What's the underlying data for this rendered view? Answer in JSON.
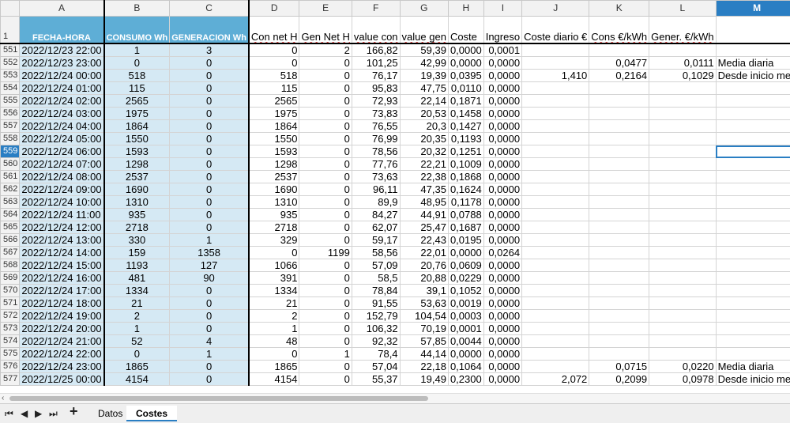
{
  "columns": [
    "",
    "A",
    "B",
    "C",
    "D",
    "E",
    "F",
    "G",
    "H",
    "I",
    "J",
    "K",
    "L",
    "M"
  ],
  "selected_column": "M",
  "selected_row": "559",
  "header_row": {
    "row_number": "1",
    "fecha_hora": "FECHA-HORA",
    "consumo": "CONSUMO Wh",
    "generacion": "GENERACION Wh",
    "con_net": "Con net H",
    "gen_net": "Gen Net H",
    "value_con": "value con",
    "value_gen": "value gen",
    "coste": "Coste",
    "ingreso": "Ingreso",
    "coste_diario": "Coste diario €",
    "cons_kwh": "Cons €/kWh",
    "gener_kwh": "Gener. €/kWh",
    "m": ""
  },
  "rows": [
    {
      "n": "551",
      "a": "2022/12/23 22:00",
      "b": "1",
      "c": "3",
      "d": "0",
      "e": "2",
      "f": "166,82",
      "g": "59,39",
      "h": "0,0000",
      "i": "0,0001",
      "j": "",
      "k": "",
      "l": "",
      "m": ""
    },
    {
      "n": "552",
      "a": "2022/12/23 23:00",
      "b": "0",
      "c": "0",
      "d": "0",
      "e": "0",
      "f": "101,25",
      "g": "42,99",
      "h": "0,0000",
      "i": "0,0000",
      "j": "",
      "k": "0,0477",
      "l": "0,0111",
      "m": "Media diaria"
    },
    {
      "n": "553",
      "a": "2022/12/24 00:00",
      "b": "518",
      "c": "0",
      "d": "518",
      "e": "0",
      "f": "76,17",
      "g": "19,39",
      "h": "0,0395",
      "i": "0,0000",
      "j": "1,410",
      "k": "0,2164",
      "l": "0,1029",
      "m": "Desde inicio mes"
    },
    {
      "n": "554",
      "a": "2022/12/24 01:00",
      "b": "115",
      "c": "0",
      "d": "115",
      "e": "0",
      "f": "95,83",
      "g": "47,75",
      "h": "0,0110",
      "i": "0,0000",
      "j": "",
      "k": "",
      "l": "",
      "m": ""
    },
    {
      "n": "555",
      "a": "2022/12/24 02:00",
      "b": "2565",
      "c": "0",
      "d": "2565",
      "e": "0",
      "f": "72,93",
      "g": "22,14",
      "h": "0,1871",
      "i": "0,0000",
      "j": "",
      "k": "",
      "l": "",
      "m": ""
    },
    {
      "n": "556",
      "a": "2022/12/24 03:00",
      "b": "1975",
      "c": "0",
      "d": "1975",
      "e": "0",
      "f": "73,83",
      "g": "20,53",
      "h": "0,1458",
      "i": "0,0000",
      "j": "",
      "k": "",
      "l": "",
      "m": ""
    },
    {
      "n": "557",
      "a": "2022/12/24 04:00",
      "b": "1864",
      "c": "0",
      "d": "1864",
      "e": "0",
      "f": "76,55",
      "g": "20,3",
      "h": "0,1427",
      "i": "0,0000",
      "j": "",
      "k": "",
      "l": "",
      "m": ""
    },
    {
      "n": "558",
      "a": "2022/12/24 05:00",
      "b": "1550",
      "c": "0",
      "d": "1550",
      "e": "0",
      "f": "76,99",
      "g": "20,35",
      "h": "0,1193",
      "i": "0,0000",
      "j": "",
      "k": "",
      "l": "",
      "m": ""
    },
    {
      "n": "559",
      "a": "2022/12/24 06:00",
      "b": "1593",
      "c": "0",
      "d": "1593",
      "e": "0",
      "f": "78,56",
      "g": "20,32",
      "h": "0,1251",
      "i": "0,0000",
      "j": "",
      "k": "",
      "l": "",
      "m": ""
    },
    {
      "n": "560",
      "a": "2022/12/24 07:00",
      "b": "1298",
      "c": "0",
      "d": "1298",
      "e": "0",
      "f": "77,76",
      "g": "22,21",
      "h": "0,1009",
      "i": "0,0000",
      "j": "",
      "k": "",
      "l": "",
      "m": ""
    },
    {
      "n": "561",
      "a": "2022/12/24 08:00",
      "b": "2537",
      "c": "0",
      "d": "2537",
      "e": "0",
      "f": "73,63",
      "g": "22,38",
      "h": "0,1868",
      "i": "0,0000",
      "j": "",
      "k": "",
      "l": "",
      "m": ""
    },
    {
      "n": "562",
      "a": "2022/12/24 09:00",
      "b": "1690",
      "c": "0",
      "d": "1690",
      "e": "0",
      "f": "96,11",
      "g": "47,35",
      "h": "0,1624",
      "i": "0,0000",
      "j": "",
      "k": "",
      "l": "",
      "m": ""
    },
    {
      "n": "563",
      "a": "2022/12/24 10:00",
      "b": "1310",
      "c": "0",
      "d": "1310",
      "e": "0",
      "f": "89,9",
      "g": "48,95",
      "h": "0,1178",
      "i": "0,0000",
      "j": "",
      "k": "",
      "l": "",
      "m": ""
    },
    {
      "n": "564",
      "a": "2022/12/24 11:00",
      "b": "935",
      "c": "0",
      "d": "935",
      "e": "0",
      "f": "84,27",
      "g": "44,91",
      "h": "0,0788",
      "i": "0,0000",
      "j": "",
      "k": "",
      "l": "",
      "m": ""
    },
    {
      "n": "565",
      "a": "2022/12/24 12:00",
      "b": "2718",
      "c": "0",
      "d": "2718",
      "e": "0",
      "f": "62,07",
      "g": "25,47",
      "h": "0,1687",
      "i": "0,0000",
      "j": "",
      "k": "",
      "l": "",
      "m": ""
    },
    {
      "n": "566",
      "a": "2022/12/24 13:00",
      "b": "330",
      "c": "1",
      "d": "329",
      "e": "0",
      "f": "59,17",
      "g": "22,43",
      "h": "0,0195",
      "i": "0,0000",
      "j": "",
      "k": "",
      "l": "",
      "m": ""
    },
    {
      "n": "567",
      "a": "2022/12/24 14:00",
      "b": "159",
      "c": "1358",
      "d": "0",
      "e": "1199",
      "f": "58,56",
      "g": "22,01",
      "h": "0,0000",
      "i": "0,0264",
      "j": "",
      "k": "",
      "l": "",
      "m": ""
    },
    {
      "n": "568",
      "a": "2022/12/24 15:00",
      "b": "1193",
      "c": "127",
      "d": "1066",
      "e": "0",
      "f": "57,09",
      "g": "20,76",
      "h": "0,0609",
      "i": "0,0000",
      "j": "",
      "k": "",
      "l": "",
      "m": ""
    },
    {
      "n": "569",
      "a": "2022/12/24 16:00",
      "b": "481",
      "c": "90",
      "d": "391",
      "e": "0",
      "f": "58,5",
      "g": "20,88",
      "h": "0,0229",
      "i": "0,0000",
      "j": "",
      "k": "",
      "l": "",
      "m": ""
    },
    {
      "n": "570",
      "a": "2022/12/24 17:00",
      "b": "1334",
      "c": "0",
      "d": "1334",
      "e": "0",
      "f": "78,84",
      "g": "39,1",
      "h": "0,1052",
      "i": "0,0000",
      "j": "",
      "k": "",
      "l": "",
      "m": ""
    },
    {
      "n": "571",
      "a": "2022/12/24 18:00",
      "b": "21",
      "c": "0",
      "d": "21",
      "e": "0",
      "f": "91,55",
      "g": "53,63",
      "h": "0,0019",
      "i": "0,0000",
      "j": "",
      "k": "",
      "l": "",
      "m": ""
    },
    {
      "n": "572",
      "a": "2022/12/24 19:00",
      "b": "2",
      "c": "0",
      "d": "2",
      "e": "0",
      "f": "152,79",
      "g": "104,54",
      "h": "0,0003",
      "i": "0,0000",
      "j": "",
      "k": "",
      "l": "",
      "m": ""
    },
    {
      "n": "573",
      "a": "2022/12/24 20:00",
      "b": "1",
      "c": "0",
      "d": "1",
      "e": "0",
      "f": "106,32",
      "g": "70,19",
      "h": "0,0001",
      "i": "0,0000",
      "j": "",
      "k": "",
      "l": "",
      "m": ""
    },
    {
      "n": "574",
      "a": "2022/12/24 21:00",
      "b": "52",
      "c": "4",
      "d": "48",
      "e": "0",
      "f": "92,32",
      "g": "57,85",
      "h": "0,0044",
      "i": "0,0000",
      "j": "",
      "k": "",
      "l": "",
      "m": ""
    },
    {
      "n": "575",
      "a": "2022/12/24 22:00",
      "b": "0",
      "c": "1",
      "d": "0",
      "e": "1",
      "f": "78,4",
      "g": "44,14",
      "h": "0,0000",
      "i": "0,0000",
      "j": "",
      "k": "",
      "l": "",
      "m": ""
    },
    {
      "n": "576",
      "a": "2022/12/24 23:00",
      "b": "1865",
      "c": "0",
      "d": "1865",
      "e": "0",
      "f": "57,04",
      "g": "22,18",
      "h": "0,1064",
      "i": "0,0000",
      "j": "",
      "k": "0,0715",
      "l": "0,0220",
      "m": "Media diaria"
    },
    {
      "n": "577",
      "a": "2022/12/25 00:00",
      "b": "4154",
      "c": "0",
      "d": "4154",
      "e": "0",
      "f": "55,37",
      "g": "19,49",
      "h": "0,2300",
      "i": "0,0000",
      "j": "2,072",
      "k": "0,2099",
      "l": "0,0978",
      "m": "Desde inicio mes"
    }
  ],
  "sheet_tabs": [
    "Datos",
    "Costes"
  ],
  "active_tab": "Costes",
  "nav": {
    "first": "⏮",
    "prev": "◀",
    "next": "▶",
    "last": "⏭",
    "add": "+"
  },
  "colors": {
    "accent": "#2a7ec3",
    "header_blue": "#5eaed6",
    "cell_blue": "#d5e9f4"
  }
}
